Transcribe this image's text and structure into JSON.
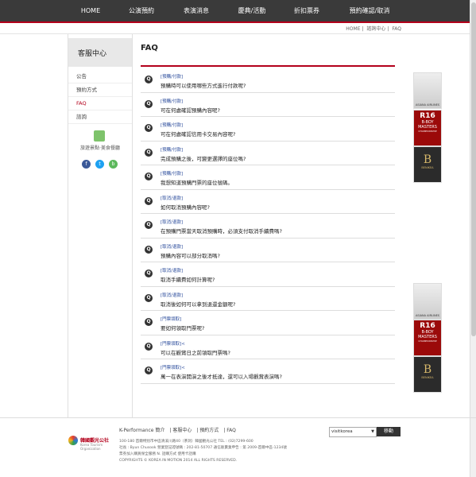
{
  "nav": {
    "items": [
      "HOME",
      "公演預約",
      "表演消息",
      "慶典/活動",
      "折扣票券",
      "預約確認/取消"
    ]
  },
  "breadcrumb": [
    "HOME",
    "諮詢中心",
    "FAQ"
  ],
  "sidebar": {
    "heading": "客服中心",
    "items": [
      "公告",
      "預約方式",
      "FAQ",
      "諮詢"
    ],
    "active": 2,
    "map_label": "旅遊景點·美食餐廳",
    "social": [
      "f",
      "t",
      "b"
    ]
  },
  "main": {
    "title": "FAQ",
    "faqs": [
      {
        "cat": "[預購/付款]",
        "q": "預購時可以使用哪些方式進行付款呢?"
      },
      {
        "cat": "[預購/付款]",
        "q": "可在何處確認預購內容呢?"
      },
      {
        "cat": "[預購/付款]",
        "q": "可在何處確認信用卡交易內容呢?"
      },
      {
        "cat": "[預購/付款]",
        "q": "完成預購之後，可變更選擇的座位嗎?"
      },
      {
        "cat": "[預購/付款]",
        "q": "我想知道預購門票的座位號碼。"
      },
      {
        "cat": "[取消/退款]",
        "q": "如何取消預購內容呢?"
      },
      {
        "cat": "[取消/退款]",
        "q": "在預購門票當天取消預購時，必須支付取消手續費嗎?"
      },
      {
        "cat": "[取消/退款]",
        "q": "預購內容可以部分取消嗎?"
      },
      {
        "cat": "[取消/退款]",
        "q": "取消手續費如何計算呢?"
      },
      {
        "cat": "[取消/退款]",
        "q": "取消後如何可以拿到退還金額呢?"
      },
      {
        "cat": "[門票領取]",
        "q": "要如何領取門票呢?"
      },
      {
        "cat": "[門票領取]<",
        "q": "可以在觀賞日之前領取門票嗎?"
      },
      {
        "cat": "[門票領取]<",
        "q": "萬一在表演開演之後才抵達，還可以入場觀賞表演嗎?"
      }
    ]
  },
  "ads": {
    "airline": "ASIANA AIRLINES",
    "bboy_lines": [
      "R16",
      "B-BOY",
      "MASTERS",
      "CHAMPIONSHIP"
    ],
    "benikea": "BENIKEA"
  },
  "footer": {
    "links": [
      "K-Performance 簡介",
      "客服中心",
      "預約方式",
      "FAQ"
    ],
    "logo_name": "韓國觀光公社",
    "logo_sub": "Korea Tourism Organization",
    "address_lines": [
      "100-180 首爾特別市中區清溪川路40（茶洞）韓國觀光公社   TEL : (02)7299-600",
      "社長 : Byun Chusook  營業登記證號碼 : 202-81-50707  通信販賣業申告 : 第 2009-首爾中區-1234號",
      "票券加入購買保全服務   N. 話購方式   使用卡話購",
      "COPYRIGHTS © KOREA IN MOTION 2014 ALL RIGHTS RESERVED."
    ],
    "site_select": "visitkorea",
    "go_label": "移動"
  }
}
